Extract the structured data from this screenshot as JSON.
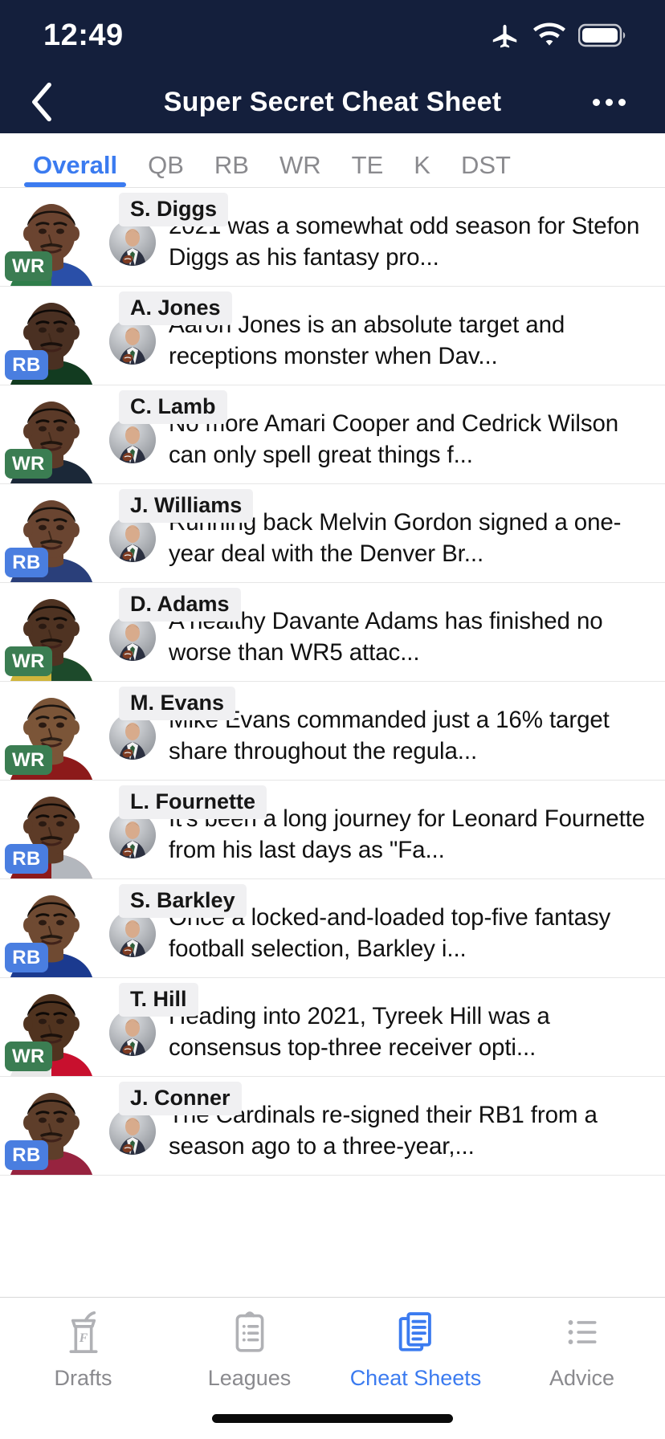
{
  "status_bar": {
    "time": "12:49",
    "icons": [
      "airplane-mode-icon",
      "wifi-icon",
      "battery-icon"
    ]
  },
  "nav": {
    "back_icon": "chevron-left-icon",
    "title": "Super Secret Cheat Sheet",
    "more_icon": "overflow-menu-icon"
  },
  "position_tabs": {
    "active": "Overall",
    "items": [
      {
        "label": "Overall",
        "active": true
      },
      {
        "label": "QB",
        "active": false
      },
      {
        "label": "RB",
        "active": false
      },
      {
        "label": "WR",
        "active": false
      },
      {
        "label": "TE",
        "active": false
      },
      {
        "label": "K",
        "active": false
      },
      {
        "label": "DST",
        "active": false
      }
    ]
  },
  "players": [
    {
      "name": "S. Diggs",
      "position": "WR",
      "blurb": "2021 was a somewhat odd season for Stefon Diggs as his fantasy pro...",
      "skin": "#6b4430",
      "hair": "#17110d",
      "jersey_left": "#2f7d4a",
      "jersey_right": "#2a4fa8"
    },
    {
      "name": "A. Jones",
      "position": "RB",
      "blurb": "Aaron Jones is an absolute target and receptions monster when Dav...",
      "skin": "#4a3022",
      "hair": "#0d0907",
      "jersey_left": "#123b20",
      "jersey_right": "#123b20"
    },
    {
      "name": "C. Lamb",
      "position": "WR",
      "blurb": "No more Amari Cooper and Cedrick Wilson can only spell great things f...",
      "skin": "#5b3a28",
      "hair": "#110c08",
      "jersey_left": "#1b2838",
      "jersey_right": "#1b2838"
    },
    {
      "name": "J. Williams",
      "position": "RB",
      "blurb": "Running back Melvin Gordon signed a one-year deal with the Denver Br...",
      "skin": "#6a4531",
      "hair": "#14100c",
      "jersey_left": "#2a3f7a",
      "jersey_right": "#2a3f7a"
    },
    {
      "name": "D. Adams",
      "position": "WR",
      "blurb": "A healthy Davante Adams has finished no worse than WR5 attac...",
      "skin": "#4f3322",
      "hair": "#0e0a07",
      "jersey_left": "#cfb53b",
      "jersey_right": "#1d4a2b"
    },
    {
      "name": "M. Evans",
      "position": "WR",
      "blurb": "Mike Evans commanded just a 16% target share throughout the regula...",
      "skin": "#7b5538",
      "hair": "#1a1410",
      "jersey_left": "#8c1a1a",
      "jersey_right": "#8c1a1a"
    },
    {
      "name": "L. Fournette",
      "position": "RB",
      "blurb": "It's been a long journey for Leonard Fournette from his last days as \"Fa...",
      "skin": "#5d3b27",
      "hair": "#100b08",
      "jersey_left": "#8c1a1a",
      "jersey_right": "#b3b7bd"
    },
    {
      "name": "S. Barkley",
      "position": "RB",
      "blurb": "Once a locked-and-loaded top-five fantasy football selection, Barkley i...",
      "skin": "#6f4a32",
      "hair": "#120d09",
      "jersey_left": "#1b3a8f",
      "jersey_right": "#1b3a8f"
    },
    {
      "name": "T. Hill",
      "position": "WR",
      "blurb": "Heading into 2021, Tyreek Hill was a consensus top-three receiver opti...",
      "skin": "#50331f",
      "hair": "#0c0806",
      "jersey_left": "#e8e8e8",
      "jersey_right": "#c8102e"
    },
    {
      "name": "J. Conner",
      "position": "RB",
      "blurb": "The Cardinals re-signed their RB1 from a season ago to a three-year,...",
      "skin": "#5e3e2a",
      "hair": "#110c09",
      "jersey_left": "#97233f",
      "jersey_right": "#97233f"
    }
  ],
  "bottom_nav": {
    "items": [
      {
        "label": "Drafts",
        "icon": "draft-podium-icon",
        "active": false
      },
      {
        "label": "Leagues",
        "icon": "clipboard-icon",
        "active": false
      },
      {
        "label": "Cheat Sheets",
        "icon": "documents-stack-icon",
        "active": true
      },
      {
        "label": "Advice",
        "icon": "bulleted-list-icon",
        "active": false
      }
    ]
  },
  "colors": {
    "header_navy": "#141f3c",
    "accent_blue": "#3b7bf0",
    "wr_green": "#3b7d52",
    "rb_blue": "#4a7ee0",
    "inactive_gray": "#8a8a8e"
  }
}
